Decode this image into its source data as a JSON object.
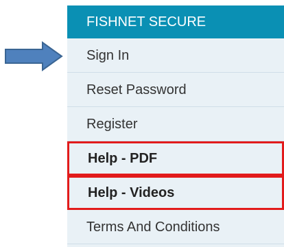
{
  "annotation": {
    "arrow_icon": "right-arrow-icon",
    "arrow_color": "#4f81bd",
    "arrow_border": "#3a6593",
    "highlight_color": "#e21b1b"
  },
  "menu": {
    "header": "FISHNET SECURE",
    "header_color": "#0a90b4",
    "items": [
      {
        "label": "Sign In"
      },
      {
        "label": "Reset Password"
      },
      {
        "label": "Register"
      },
      {
        "label": "Help - PDF"
      },
      {
        "label": "Help - Videos"
      },
      {
        "label": "Terms And Conditions"
      }
    ]
  }
}
